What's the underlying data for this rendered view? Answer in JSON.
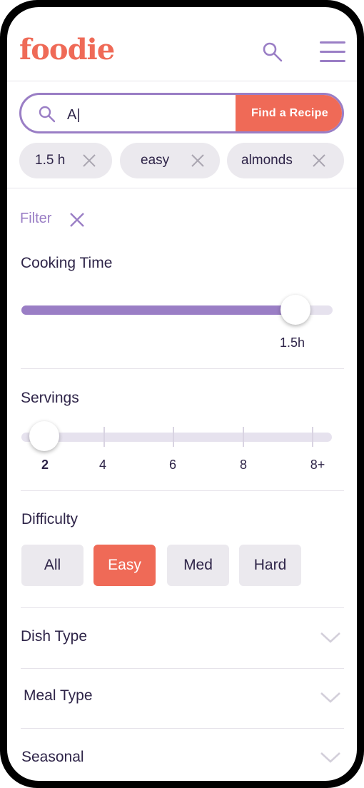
{
  "header": {
    "logo": "foodie",
    "search_icon": "search-icon",
    "menu_icon": "hamburger-menu-icon"
  },
  "search": {
    "value": "A|",
    "button_label": "Find a Recipe"
  },
  "chips": [
    {
      "label": "1.5 h"
    },
    {
      "label": "easy"
    },
    {
      "label": "almonds"
    }
  ],
  "filter": {
    "label": "Filter"
  },
  "cooking_time": {
    "title": "Cooking Time",
    "value_label": "1.5h",
    "fill_fraction": 0.88
  },
  "servings": {
    "title": "Servings",
    "ticks": [
      "2",
      "4",
      "6",
      "8",
      "8+"
    ],
    "selected": "2"
  },
  "difficulty": {
    "title": "Difficulty",
    "options": [
      "All",
      "Easy",
      "Med",
      "Hard"
    ],
    "selected": "Easy"
  },
  "accordions": [
    {
      "title": "Dish Type"
    },
    {
      "title": "Meal Type"
    },
    {
      "title": "Seasonal"
    }
  ],
  "colors": {
    "brand": "#ef6a57",
    "accent": "#9a7ec5",
    "text": "#2e2448",
    "chip_bg": "#ebe9ee"
  }
}
